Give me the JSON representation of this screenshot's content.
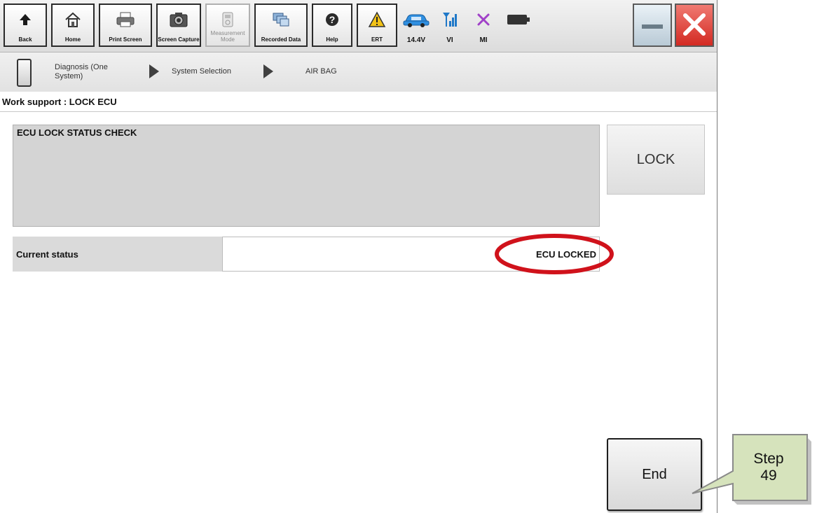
{
  "toolbar": {
    "buttons": [
      {
        "label": "Back",
        "icon": "back-arrow-icon"
      },
      {
        "label": "Home",
        "icon": "home-icon"
      },
      {
        "label": "Print Screen",
        "icon": "printer-icon"
      },
      {
        "label": "Screen Capture",
        "icon": "camera-icon"
      },
      {
        "label": "Measurement Mode",
        "icon": "meter-icon",
        "disabled": true
      },
      {
        "label": "Recorded Data",
        "icon": "recorded-data-icon"
      },
      {
        "label": "Help",
        "icon": "help-icon"
      },
      {
        "label": "ERT",
        "icon": "warning-icon"
      }
    ],
    "status": {
      "voltage": "14.4V",
      "vi_label": "VI",
      "mi_label": "MI"
    }
  },
  "breadcrumb": {
    "items": [
      "Diagnosis (One System)",
      "System Selection",
      "AIR BAG"
    ]
  },
  "work_support": {
    "title": "Work support : LOCK ECU"
  },
  "check_panel": {
    "title": "ECU LOCK STATUS CHECK",
    "lock_button": "LOCK"
  },
  "status": {
    "label": "Current status",
    "value": "ECU LOCKED"
  },
  "end_button": "End",
  "callout": {
    "line1": "Step",
    "line2": "49"
  },
  "colors": {
    "highlight_ring": "#d0121b",
    "callout_fill": "#d6e3bc",
    "callout_border": "#8a8a8a",
    "close_button": "#e0302a"
  }
}
